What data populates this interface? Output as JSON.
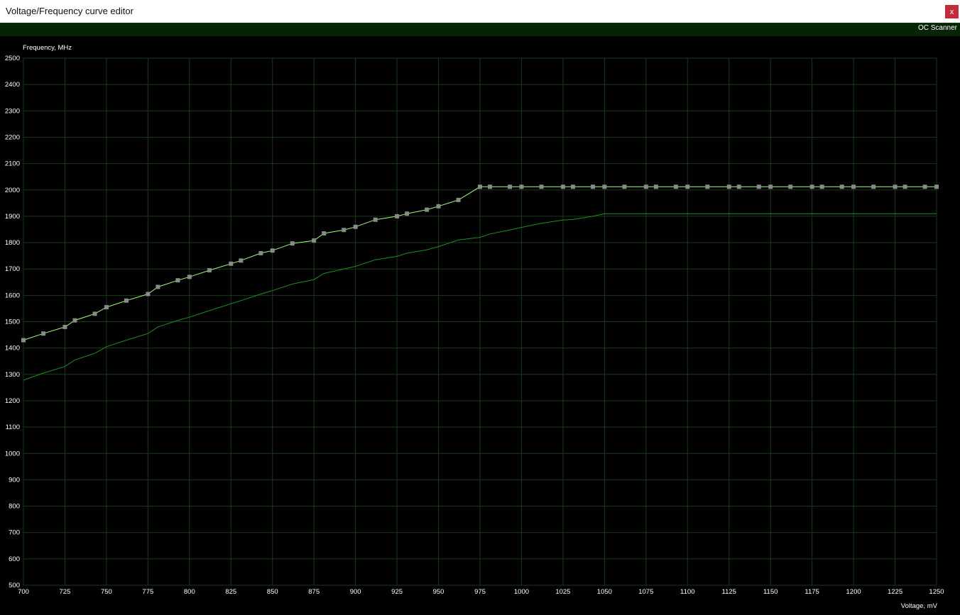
{
  "window": {
    "title": "Voltage/Frequency curve editor",
    "close_label": "x"
  },
  "toolbar": {
    "oc_scanner_label": "OC Scanner"
  },
  "colors": {
    "background": "#000000",
    "grid": "#1a3a1a",
    "curve": "#9cff7a",
    "curve_points": "#8a8a8a",
    "baseline": "#1f8f1f",
    "toolbar_bg": "#062306",
    "close_button": "#c42b3a"
  },
  "chart_data": {
    "type": "line",
    "xlabel": "Voltage, mV",
    "ylabel": "Frequency, MHz",
    "xlim": [
      700,
      1250
    ],
    "ylim": [
      500,
      2500
    ],
    "xticks": [
      700,
      725,
      750,
      775,
      800,
      825,
      850,
      875,
      900,
      925,
      950,
      975,
      1000,
      1025,
      1050,
      1075,
      1100,
      1125,
      1150,
      1175,
      1200,
      1225,
      1250
    ],
    "yticks": [
      500,
      600,
      700,
      800,
      900,
      1000,
      1100,
      1200,
      1300,
      1400,
      1500,
      1600,
      1700,
      1800,
      1900,
      2000,
      2100,
      2200,
      2300,
      2400,
      2500
    ],
    "grid": true,
    "series": [
      {
        "role": "edited-curve",
        "markers": true,
        "x": [
          700,
          712,
          725,
          731,
          743,
          750,
          762,
          775,
          781,
          793,
          800,
          812,
          825,
          831,
          843,
          850,
          862,
          875,
          881,
          893,
          900,
          912,
          925,
          931,
          943,
          950,
          962,
          975,
          981,
          993,
          1000,
          1012,
          1025,
          1031,
          1043,
          1050,
          1062,
          1075,
          1081,
          1093,
          1100,
          1112,
          1125,
          1131,
          1143,
          1150,
          1162,
          1175,
          1181,
          1193,
          1200,
          1212,
          1225,
          1231,
          1243,
          1250
        ],
        "y": [
          1430,
          1455,
          1480,
          1505,
          1530,
          1555,
          1580,
          1605,
          1632,
          1657,
          1670,
          1695,
          1720,
          1732,
          1760,
          1770,
          1797,
          1808,
          1835,
          1848,
          1860,
          1887,
          1900,
          1910,
          1925,
          1938,
          1962,
          2012,
          2012,
          2012,
          2012,
          2012,
          2012,
          2012,
          2012,
          2012,
          2012,
          2012,
          2012,
          2012,
          2012,
          2012,
          2012,
          2012,
          2012,
          2012,
          2012,
          2012,
          2012,
          2012,
          2012,
          2012,
          2012,
          2012,
          2012,
          2012
        ]
      },
      {
        "role": "default-curve",
        "markers": false,
        "x": [
          700,
          712,
          725,
          731,
          743,
          750,
          762,
          775,
          781,
          793,
          800,
          812,
          825,
          831,
          843,
          850,
          862,
          875,
          881,
          893,
          900,
          912,
          925,
          931,
          943,
          950,
          962,
          975,
          981,
          993,
          1000,
          1012,
          1025,
          1031,
          1043,
          1050,
          1250
        ],
        "y": [
          1278,
          1305,
          1330,
          1355,
          1380,
          1405,
          1430,
          1455,
          1480,
          1505,
          1517,
          1542,
          1568,
          1580,
          1605,
          1618,
          1643,
          1660,
          1683,
          1700,
          1710,
          1735,
          1748,
          1760,
          1773,
          1785,
          1810,
          1820,
          1833,
          1848,
          1858,
          1873,
          1886,
          1888,
          1900,
          1910,
          1910
        ]
      }
    ]
  }
}
